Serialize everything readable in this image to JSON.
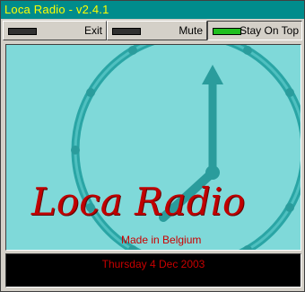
{
  "window": {
    "title": "Loca Radio - v2.4.1"
  },
  "toolbar": {
    "exit_label": "Exit",
    "mute_label": "Mute",
    "stay_on_top_label": "Stay On Top"
  },
  "display": {
    "logo_text": "Loca Radio",
    "made_in": "Made in Belgium"
  },
  "status": {
    "date": "Thursday 4 Dec 2003"
  },
  "colors": {
    "title_bg": "#008c8c",
    "title_text": "#ffff00",
    "display_bg": "#7fd9d9",
    "logo": "#c00000",
    "led_on": "#1fbf1f"
  }
}
